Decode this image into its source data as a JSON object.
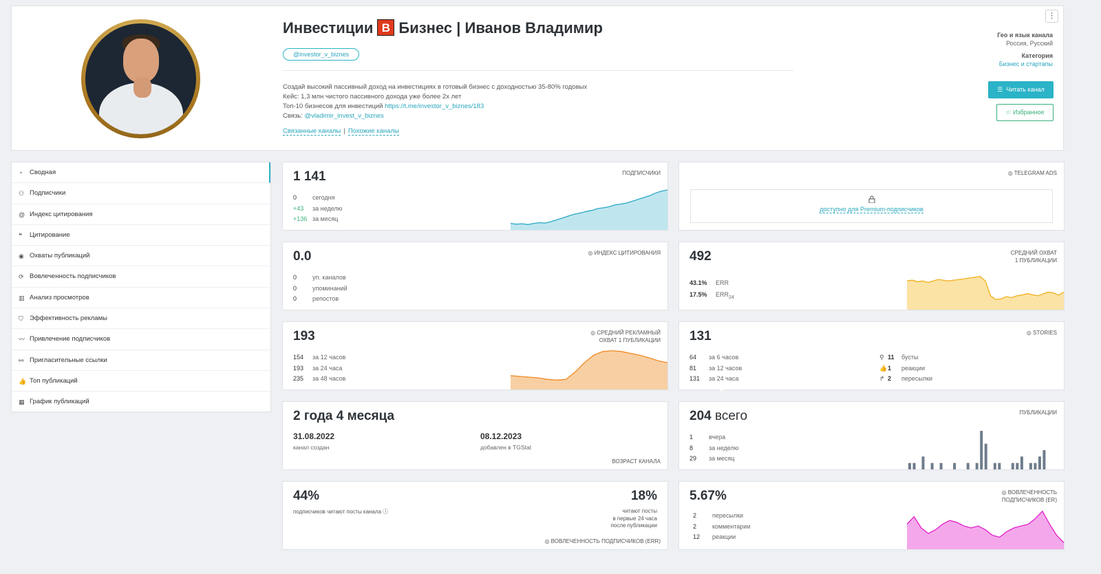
{
  "header": {
    "title_part1": "Инвестиции",
    "title_badge": "B",
    "title_part2": "Бизнес | Иванов Владимир",
    "handle": "@investor_v_biznes",
    "desc_line1": "Создай высокий пассивный доход на инвестициях в готовый бизнес с доходностью 35-80% годовых",
    "desc_line2": "Кейс: 1,3 млн чистого пассивного дохода уже более 2х лет",
    "desc_line3_prefix": "Топ-10 бизнесов для инвестиций ",
    "desc_line3_link": "https://t.me/investor_v_biznes/183",
    "desc_line4_prefix": "Связь: ",
    "desc_line4_link": "@vladimir_invest_v_biznes",
    "related_link": "Связанные каналы",
    "related_sep": "|",
    "similar_link": "Похожие каналы",
    "geo_label": "Гео и язык канала",
    "geo_value": "Россия, Русский",
    "category_label": "Категория",
    "category_value": "Бизнес и стартапы",
    "read_button": "Читать канал",
    "fav_button": "Избранное",
    "accent": "#2bb3c7"
  },
  "sidebar": {
    "items": [
      {
        "label": "Сводная",
        "icon": "pie-icon"
      },
      {
        "label": "Подписчики",
        "icon": "users-icon"
      },
      {
        "label": "Индекс цитирования",
        "icon": "at-icon"
      },
      {
        "label": "Цитирование",
        "icon": "quote-icon"
      },
      {
        "label": "Охваты публикаций",
        "icon": "eye-icon"
      },
      {
        "label": "Вовлеченность подписчиков",
        "icon": "engagement-icon"
      },
      {
        "label": "Анализ просмотров",
        "icon": "bar-chart-icon"
      },
      {
        "label": "Эффективность рекламы",
        "icon": "tag-icon"
      },
      {
        "label": "Привлечение подписчиков",
        "icon": "trend-icon"
      },
      {
        "label": "Пригласительные ссылки",
        "icon": "link-icon"
      },
      {
        "label": "Топ публикаций",
        "icon": "thumbs-up-icon"
      },
      {
        "label": "График публикаций",
        "icon": "calendar-icon"
      }
    ]
  },
  "cards": {
    "subscribers": {
      "value": "1 141",
      "label": "ПОДПИСЧИКИ",
      "rows": [
        {
          "n": "0",
          "t": "сегодня"
        },
        {
          "n": "+43",
          "t": "за неделю"
        },
        {
          "n": "+136",
          "t": "за месяц"
        }
      ],
      "spark": [
        0.1,
        0.08,
        0.09,
        0.07,
        0.1,
        0.12,
        0.11,
        0.15,
        0.2,
        0.25,
        0.3,
        0.35,
        0.38,
        0.42,
        0.45,
        0.5,
        0.52,
        0.55,
        0.6,
        0.62,
        0.65,
        0.7,
        0.75,
        0.8,
        0.85,
        0.92,
        0.97,
        1.0
      ]
    },
    "ads": {
      "label": "TELEGRAM ADS",
      "locked_text": "доступно для Premium-подписчиков"
    },
    "citation": {
      "value": "0.0",
      "label": "ИНДЕКС ЦИТИРОВАНИЯ",
      "rows": [
        {
          "n": "0",
          "t": "уп. каналов"
        },
        {
          "n": "0",
          "t": "упоминаний"
        },
        {
          "n": "0",
          "t": "репостов"
        }
      ]
    },
    "reach": {
      "value": "492",
      "label1": "СРЕДНИЙ ОХВАТ",
      "label2": "1 ПУБЛИКАЦИИ",
      "err_value": "43.1%",
      "err_label": "ERR",
      "err24_value": "17.5%",
      "err24_label": "ERR",
      "err24_sub": "24",
      "spark": [
        0.7,
        0.72,
        0.68,
        0.7,
        0.66,
        0.7,
        0.74,
        0.72,
        0.7,
        0.72,
        0.74,
        0.76,
        0.78,
        0.8,
        0.82,
        0.7,
        0.3,
        0.2,
        0.22,
        0.28,
        0.25,
        0.3,
        0.32,
        0.36,
        0.33,
        0.3,
        0.35,
        0.4,
        0.38,
        0.32,
        0.4
      ]
    },
    "adreach": {
      "value": "193",
      "label1": "СРЕДНИЙ РЕКЛАМНЫЙ",
      "label2": "ОХВАТ 1 ПУБЛИКАЦИИ",
      "rows": [
        {
          "n": "154",
          "t": "за 12 часов"
        },
        {
          "n": "193",
          "t": "за 24 часа"
        },
        {
          "n": "235",
          "t": "за 48 часов"
        }
      ],
      "spark": [
        0.3,
        0.28,
        0.26,
        0.24,
        0.2,
        0.18,
        0.2,
        0.4,
        0.65,
        0.85,
        0.95,
        0.97,
        0.95,
        0.9,
        0.85,
        0.78,
        0.7,
        0.65
      ]
    },
    "stories": {
      "value": "131",
      "label": "STORIES",
      "rows": [
        {
          "n": "64",
          "t": "за 6 часов"
        },
        {
          "n": "81",
          "t": "за 12 часов"
        },
        {
          "n": "131",
          "t": "за 24 часа"
        }
      ],
      "right_rows": [
        {
          "n": "11",
          "t": "бусты",
          "icon": "boost-icon"
        },
        {
          "n": "1",
          "t": "реакции",
          "icon": "thumbs-up-icon"
        },
        {
          "n": "2",
          "t": "пересылки",
          "icon": "forward-icon"
        }
      ]
    },
    "age": {
      "value": "2 года 4 месяца",
      "created_date": "31.08.2022",
      "created_label": "канал создан",
      "added_date": "08.12.2023",
      "added_label": "добавлен в TGStat",
      "label": "ВОЗРАСТ КАНАЛА"
    },
    "posts": {
      "value": "204",
      "suffix": "всего",
      "label": "ПУБЛИКАЦИИ",
      "rows": [
        {
          "n": "1",
          "t": "вчера"
        },
        {
          "n": "8",
          "t": "за неделю"
        },
        {
          "n": "29",
          "t": "за месяц"
        }
      ],
      "bars": [
        1,
        1,
        0,
        2,
        0,
        1,
        0,
        1,
        0,
        0,
        1,
        0,
        0,
        1,
        0,
        1,
        6,
        4,
        0,
        1,
        1,
        0,
        0,
        1,
        1,
        2,
        0,
        1,
        1,
        2,
        3,
        0,
        0,
        0,
        0
      ]
    },
    "err": {
      "value_left": "44%",
      "desc_left": "подписчиков читают посты канала",
      "value_right": "18%",
      "desc_right1": "читают посты",
      "desc_right2": "в первые 24 часа",
      "desc_right3": "после публикации",
      "label": "ВОВЛЕЧЕННОСТЬ ПОДПИСЧИКОВ (ERR)"
    },
    "er": {
      "value": "5.67%",
      "label1": "ВОВЛЕЧЕННОСТЬ",
      "label2": "ПОДПИСЧИКОВ (ER)",
      "rows": [
        {
          "n": "2",
          "t": "пересылки"
        },
        {
          "n": "2",
          "t": "комментарии"
        },
        {
          "n": "12",
          "t": "реакции"
        }
      ],
      "spark": [
        0.6,
        0.8,
        0.5,
        0.35,
        0.45,
        0.6,
        0.7,
        0.65,
        0.55,
        0.5,
        0.55,
        0.45,
        0.3,
        0.25,
        0.4,
        0.5,
        0.55,
        0.6,
        0.75,
        0.95,
        0.6,
        0.3,
        0.1
      ]
    }
  }
}
